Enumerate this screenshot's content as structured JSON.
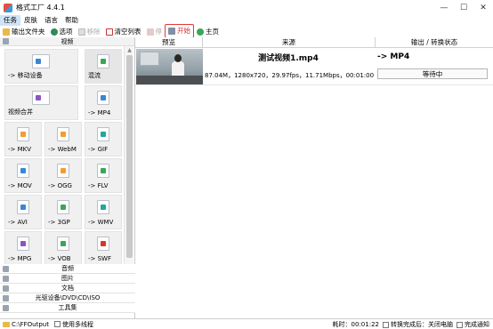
{
  "window": {
    "title": "格式工厂 4.4.1",
    "controls": [
      "—",
      "☐",
      "✕"
    ]
  },
  "menu": [
    "任务",
    "皮肤",
    "语言",
    "帮助"
  ],
  "toolbar": {
    "output_folder": "输出文件夹",
    "options": "选项",
    "remove": "移除",
    "clear_list": "清空列表",
    "stop": "停",
    "start": "开始",
    "home": "主页"
  },
  "sidebar": {
    "video_header": "视频",
    "tiles": [
      {
        "label": "-> 移动设备",
        "icon": "mobile-device-icon"
      },
      {
        "label": "混流",
        "icon": "mux-icon"
      },
      {
        "label": "视频合并",
        "icon": "video-join-icon"
      },
      {
        "label": "-> MP4",
        "icon": "mp4-file-icon"
      },
      {
        "label": "-> MKV",
        "icon": "mkv-file-icon"
      },
      {
        "label": "-> WebM",
        "icon": "webm-file-icon"
      },
      {
        "label": "-> GIF",
        "icon": "gif-file-icon"
      },
      {
        "label": "-> MOV",
        "icon": "mov-file-icon"
      },
      {
        "label": "-> OGG",
        "icon": "ogg-file-icon"
      },
      {
        "label": "-> FLV",
        "icon": "flv-file-icon"
      },
      {
        "label": "-> AVI",
        "icon": "avi-file-icon"
      },
      {
        "label": "-> 3GP",
        "icon": "3gp-file-icon"
      },
      {
        "label": "-> WMV",
        "icon": "wmv-file-icon"
      },
      {
        "label": "-> MPG",
        "icon": "mpg-file-icon"
      },
      {
        "label": "-> VOB",
        "icon": "vob-file-icon"
      },
      {
        "label": "-> SWF",
        "icon": "swf-file-icon"
      }
    ],
    "categories": [
      "音频",
      "图片",
      "文档",
      "光驱设备\\DVD\\CD\\ISO",
      "工具集"
    ]
  },
  "list": {
    "headers": {
      "preview": "预览",
      "source": "来源",
      "output": "输出 / 转换状态"
    },
    "jobs": [
      {
        "name": "测试视频1.mp4",
        "meta": "87.04M，1280x720，29.97fps，11.71Mbps，00:01:00",
        "output": "-> MP4",
        "status": "等待中"
      }
    ]
  },
  "statusbar": {
    "output_path": "C:\\FFOutput",
    "multithread": "使用多线程",
    "elapsed": "耗时：00:01:22",
    "after_done": "转换完成后：关闭电脑",
    "notify": "完成通知"
  },
  "colors": {
    "accent": "#e53935",
    "selection": "#cfe3f7"
  }
}
